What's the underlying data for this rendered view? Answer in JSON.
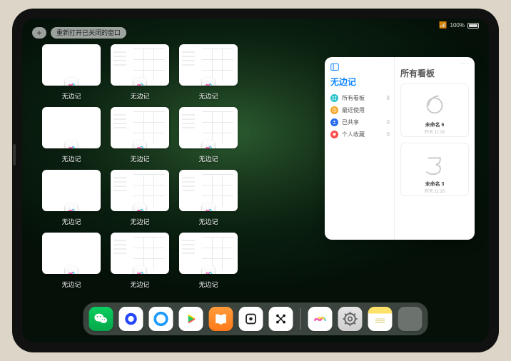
{
  "status": {
    "wifi": "wifi",
    "battery_percent": "100%"
  },
  "topbar": {
    "plus_label": "+",
    "reopen_label": "重新打开已关闭的窗口"
  },
  "overview": {
    "app_name": "无边记",
    "items": [
      {
        "label": "无边记",
        "variant": "blank"
      },
      {
        "label": "无边记",
        "variant": "grid"
      },
      {
        "label": "无边记",
        "variant": "grid"
      },
      {
        "label": "",
        "variant": "hidden"
      },
      {
        "label": "无边记",
        "variant": "blank"
      },
      {
        "label": "无边记",
        "variant": "grid"
      },
      {
        "label": "无边记",
        "variant": "grid"
      },
      {
        "label": "",
        "variant": "hidden"
      },
      {
        "label": "无边记",
        "variant": "blank"
      },
      {
        "label": "无边记",
        "variant": "grid"
      },
      {
        "label": "无边记",
        "variant": "grid"
      },
      {
        "label": "",
        "variant": "hidden"
      },
      {
        "label": "无边记",
        "variant": "blank"
      },
      {
        "label": "无边记",
        "variant": "grid"
      },
      {
        "label": "无边记",
        "variant": "grid"
      }
    ]
  },
  "panel": {
    "ellipsis": "···",
    "left_title": "无边记",
    "right_title": "所有看板",
    "nav": [
      {
        "icon": "grid",
        "color": "#2ac3c9",
        "label": "所有看板",
        "count": "8"
      },
      {
        "icon": "clock",
        "color": "#f6a623",
        "label": "最近使用",
        "count": ""
      },
      {
        "icon": "share",
        "color": "#2b6bed",
        "label": "已共享",
        "count": "0"
      },
      {
        "icon": "heart",
        "color": "#ff4d4d",
        "label": "个人收藏",
        "count": "0"
      }
    ],
    "boards": [
      {
        "label": "未命名 6",
        "sublabel": "昨天 11:29",
        "glyph": "6"
      },
      {
        "label": "未命名 3",
        "sublabel": "昨天 11:28",
        "glyph": "3"
      }
    ]
  },
  "dock": {
    "items": [
      {
        "name": "wechat"
      },
      {
        "name": "quark"
      },
      {
        "name": "qqbrowser"
      },
      {
        "name": "iqiyi"
      },
      {
        "name": "books"
      },
      {
        "name": "app-generic"
      },
      {
        "name": "app-dots"
      },
      {
        "name": "freeform"
      },
      {
        "name": "settings"
      },
      {
        "name": "notes"
      },
      {
        "name": "folder"
      }
    ]
  },
  "colors": {
    "accent": "#0a84ff"
  }
}
